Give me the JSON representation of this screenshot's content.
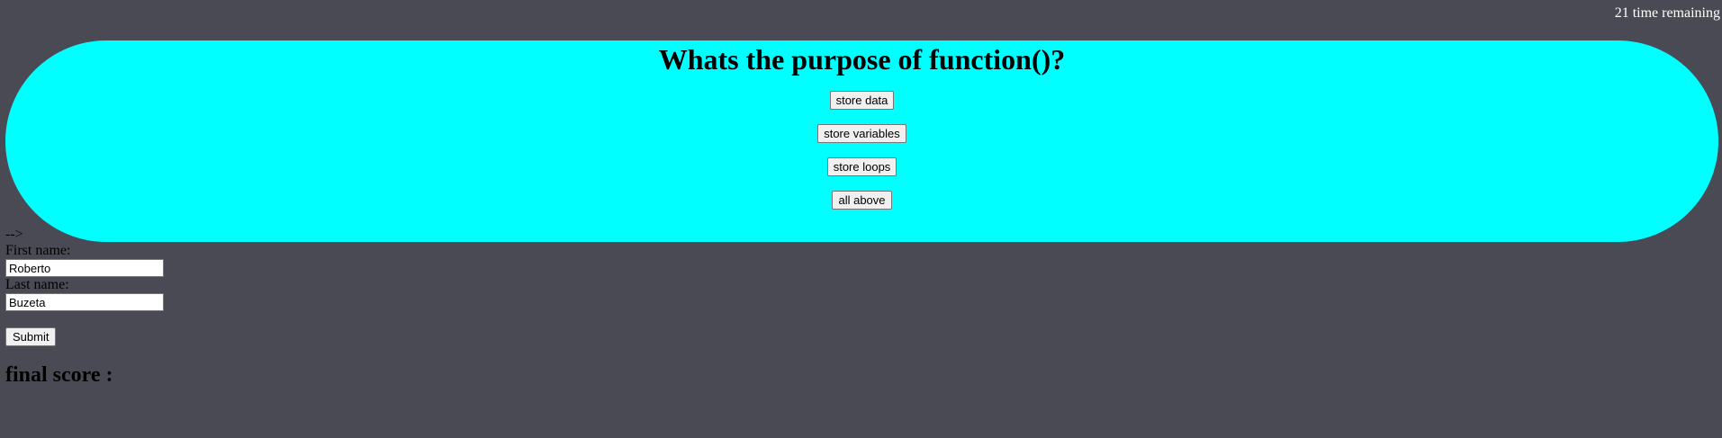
{
  "timer": {
    "text": "21 time remaining"
  },
  "quiz": {
    "question": "Whats the purpose of function()?",
    "answers": [
      {
        "label": "store data"
      },
      {
        "label": "store variables"
      },
      {
        "label": "store loops"
      },
      {
        "label": "all above"
      }
    ]
  },
  "stray_text": "-->",
  "form": {
    "first_name_label": "First name:",
    "first_name_value": "Roberto",
    "last_name_label": "Last name:",
    "last_name_value": "Buzeta",
    "submit_label": "Submit"
  },
  "score": {
    "label": "final score :"
  },
  "colors": {
    "page_background": "#4a4a54",
    "quiz_background": "#00ffff",
    "timer_text": "#ffffff"
  }
}
